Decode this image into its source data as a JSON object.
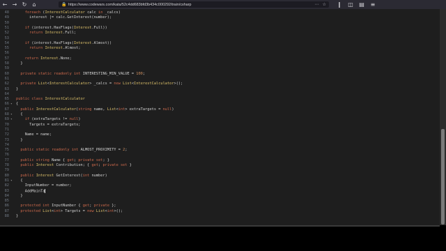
{
  "browser": {
    "url": "https://www.codewars.com/kata/52c4dd683bfd3b434c000292/train/csharp",
    "lock_icon": "lock-icon",
    "url_actions": [
      "⋯",
      "☆"
    ],
    "nav_icons": [
      "back-arrow-icon",
      "forward-arrow-icon",
      "reload-icon",
      "home-icon"
    ],
    "toolbar_icons": [
      "library-icon",
      "sidebar-icon",
      "reader-icon",
      "menu-icon"
    ]
  },
  "editor": {
    "lines": [
      {
        "n": "48",
        "fold": "",
        "text": "    foreach (InterestCalculator calc in _calcs)"
      },
      {
        "n": "49",
        "fold": "",
        "text": "      interest |= calc.GetInterest(number);"
      },
      {
        "n": "50",
        "fold": "",
        "text": ""
      },
      {
        "n": "51",
        "fold": "",
        "text": "    if (interest.HasFlags(Interest.Full))"
      },
      {
        "n": "52",
        "fold": "",
        "text": "      return Interest.Full;"
      },
      {
        "n": "53",
        "fold": "",
        "text": ""
      },
      {
        "n": "54",
        "fold": "",
        "text": "    if (interest.HasFlags(Interest.Almost))"
      },
      {
        "n": "55",
        "fold": "",
        "text": "      return Interest.Almost;"
      },
      {
        "n": "56",
        "fold": "",
        "text": ""
      },
      {
        "n": "57",
        "fold": "",
        "text": "    return Interest.None;"
      },
      {
        "n": "58",
        "fold": "",
        "text": "  }"
      },
      {
        "n": "59",
        "fold": "",
        "text": ""
      },
      {
        "n": "60",
        "fold": "",
        "text": "  private static readonly int INTERESTING_MIN_VALUE = 100;"
      },
      {
        "n": "61",
        "fold": "",
        "text": ""
      },
      {
        "n": "62",
        "fold": "",
        "text": "  private List<InterestCalculator> _calcs = new List<InterestCalculator>();"
      },
      {
        "n": "63",
        "fold": "",
        "text": "}"
      },
      {
        "n": "64",
        "fold": "",
        "text": ""
      },
      {
        "n": "65",
        "fold": "",
        "text": "public class InterestCalculator"
      },
      {
        "n": "66",
        "fold": "▾",
        "text": "{"
      },
      {
        "n": "67",
        "fold": "",
        "text": "  public InterestCalculator(string name, List<int> extraTargets = null)"
      },
      {
        "n": "68",
        "fold": "▾",
        "text": "  {"
      },
      {
        "n": "69",
        "fold": "▾",
        "text": "    if (extraTargets != null)"
      },
      {
        "n": "70",
        "fold": "",
        "text": "      Targets = extraTargets;"
      },
      {
        "n": "71",
        "fold": "",
        "text": ""
      },
      {
        "n": "72",
        "fold": "",
        "text": "    Name = name;"
      },
      {
        "n": "73",
        "fold": "",
        "text": "  }"
      },
      {
        "n": "74",
        "fold": "",
        "text": ""
      },
      {
        "n": "75",
        "fold": "",
        "text": "  public static readonly int ALMOST_PROXIMITY = 2;"
      },
      {
        "n": "76",
        "fold": "",
        "text": ""
      },
      {
        "n": "77",
        "fold": "",
        "text": "  public string Name { get; private set; }"
      },
      {
        "n": "78",
        "fold": "",
        "text": "  public Interest Contribution; { get; private set }"
      },
      {
        "n": "79",
        "fold": "",
        "text": ""
      },
      {
        "n": "80",
        "fold": "",
        "text": "  public Interest GetInterest(int number)"
      },
      {
        "n": "81",
        "fold": "▾",
        "text": "  {"
      },
      {
        "n": "82",
        "fold": "",
        "text": "    InputNumber = number;"
      },
      {
        "n": "83",
        "fold": "",
        "text": "    AddMainTa"
      },
      {
        "n": "84",
        "fold": "",
        "text": "  }"
      },
      {
        "n": "85",
        "fold": "",
        "text": ""
      },
      {
        "n": "86",
        "fold": "",
        "text": "  protected int InputNumber { get; private };"
      },
      {
        "n": "87",
        "fold": "",
        "text": "  protected List<int> Targets = new List<int>();"
      },
      {
        "n": "88",
        "fold": "",
        "text": "}"
      }
    ]
  },
  "colors": {
    "editor_bg": "#1e1e1e",
    "text": "#d4d4d4",
    "keyword": "#cf6a4c",
    "type": "#e0c46c",
    "number": "#d08f5f",
    "line_number": "#6e7681"
  }
}
